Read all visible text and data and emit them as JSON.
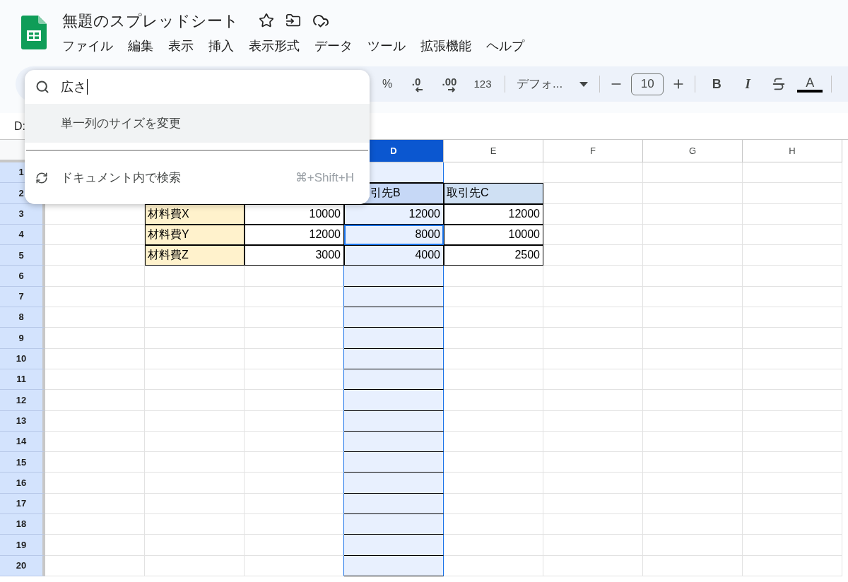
{
  "app": {
    "title": "無題のスプレッドシート",
    "menus": [
      "ファイル",
      "編集",
      "表示",
      "挿入",
      "表示形式",
      "データ",
      "ツール",
      "拡張機能",
      "ヘルプ"
    ]
  },
  "toolbar": {
    "percent": "%",
    "decimal_decrease": ".0",
    "decimal_increase": ".00",
    "number_format": "123",
    "font": "デフォ...",
    "font_size": "10",
    "bold": "B",
    "italic": "I",
    "text_color": "A"
  },
  "name_box": "D:",
  "command_search": {
    "query": "広さ",
    "results": [
      {
        "label": "単一列のサイズを変更",
        "selected": true
      },
      {
        "label": "ドキュメント内で検索",
        "shortcut": "⌘+Shift+H",
        "selected": false
      }
    ]
  },
  "grid": {
    "columns": [
      {
        "label": "D",
        "selected": true
      },
      {
        "label": "E",
        "selected": false
      },
      {
        "label": "F",
        "selected": false
      },
      {
        "label": "G",
        "selected": false
      },
      {
        "label": "H",
        "selected": false
      }
    ],
    "rows": [
      {
        "number": "1"
      },
      {
        "number": "2",
        "cells": [
          {
            "kind": "covered"
          },
          {
            "kind": "covered"
          },
          {
            "kind": "header",
            "text": "引先B"
          },
          {
            "kind": "header",
            "text": "取引先C"
          }
        ]
      },
      {
        "number": "3",
        "cells": [
          {
            "kind": "label",
            "text": "材料費X"
          },
          {
            "kind": "number",
            "text": "10000",
            "active": false
          },
          {
            "kind": "number",
            "text": "12000",
            "active": false
          },
          {
            "kind": "number",
            "text": "12000",
            "active": false
          }
        ]
      },
      {
        "number": "4",
        "cells": [
          {
            "kind": "label",
            "text": "材料費Y"
          },
          {
            "kind": "number",
            "text": "12000",
            "active": false
          },
          {
            "kind": "number",
            "text": "8000",
            "active": true
          },
          {
            "kind": "number",
            "text": "10000",
            "active": false
          }
        ]
      },
      {
        "number": "5",
        "cells": [
          {
            "kind": "label",
            "text": "材料費Z"
          },
          {
            "kind": "number",
            "text": "3000",
            "active": false
          },
          {
            "kind": "number",
            "text": "4000",
            "active": false
          },
          {
            "kind": "number",
            "text": "2500",
            "active": false
          }
        ]
      },
      {
        "number": "6"
      },
      {
        "number": "7"
      },
      {
        "number": "8"
      },
      {
        "number": "9"
      },
      {
        "number": "10"
      },
      {
        "number": "11"
      },
      {
        "number": "12"
      },
      {
        "number": "13"
      },
      {
        "number": "14"
      },
      {
        "number": "15"
      },
      {
        "number": "16"
      },
      {
        "number": "17"
      },
      {
        "number": "18"
      },
      {
        "number": "19"
      },
      {
        "number": "20"
      }
    ]
  }
}
